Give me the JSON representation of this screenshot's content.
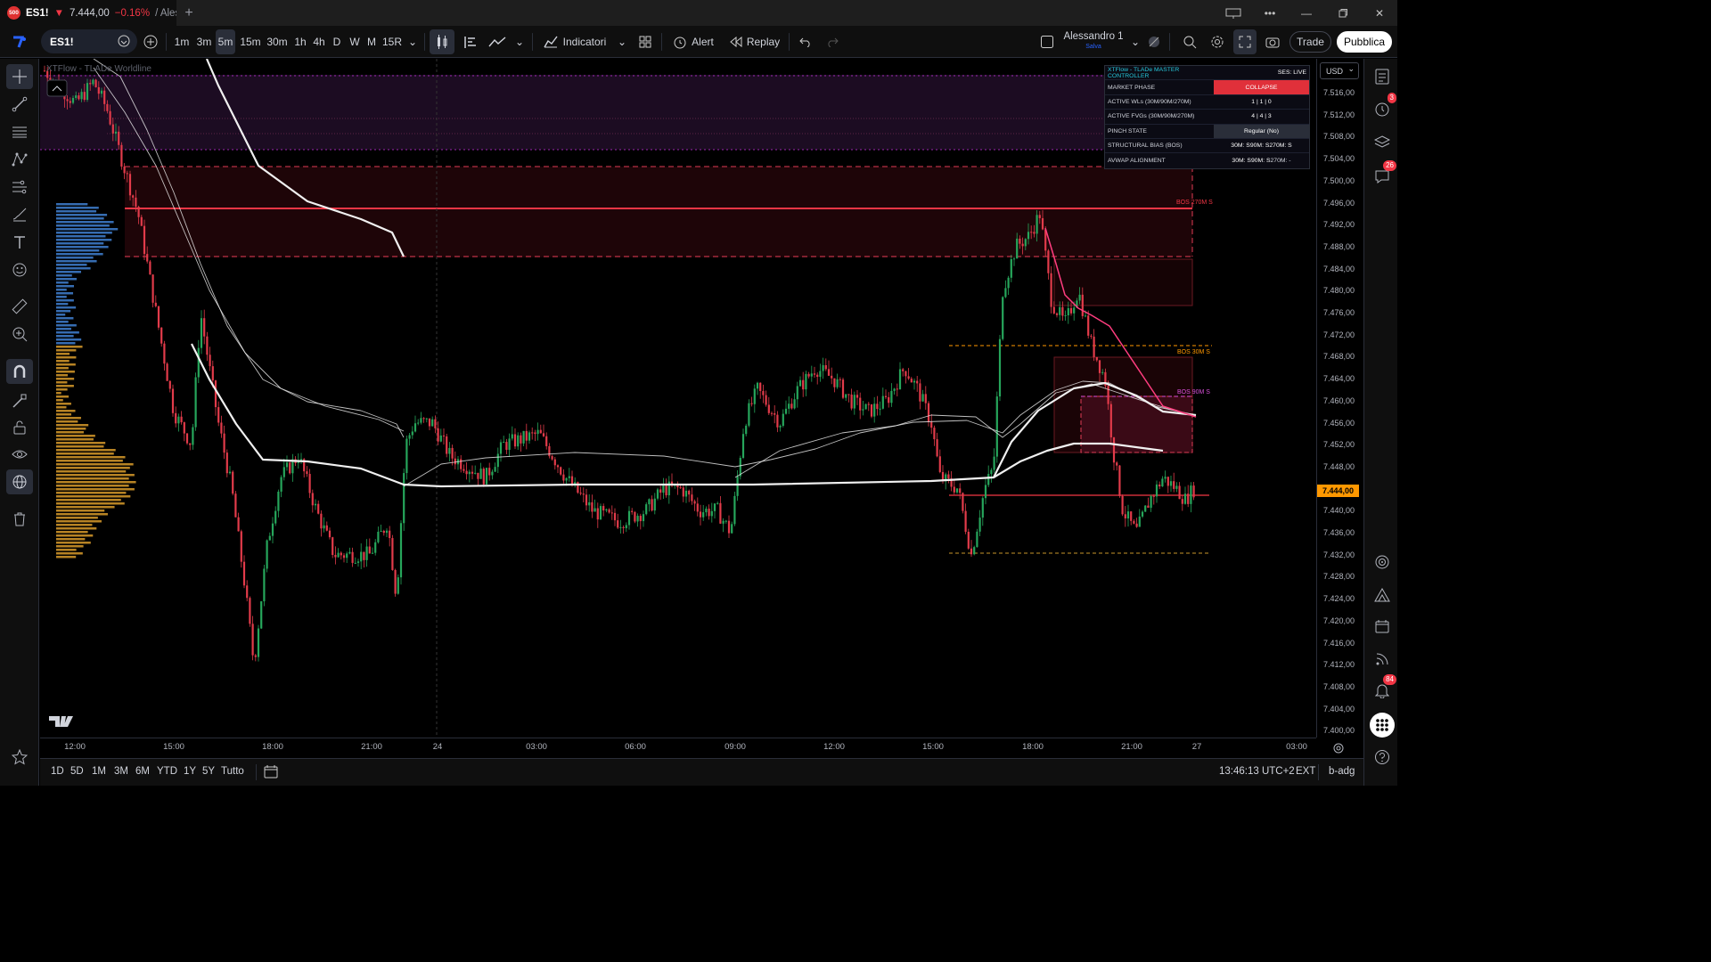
{
  "tab": {
    "badge": "500",
    "symbol": "ES1!",
    "arrow": "▼",
    "price": "7.444,00",
    "change": "−0.16%",
    "rest": "/ Alessa",
    "plus": "+"
  },
  "toolbar": {
    "symbol": "ES1!",
    "intervals": [
      "1m",
      "3m",
      "5m",
      "15m",
      "30m",
      "1h",
      "4h",
      "D",
      "W",
      "M",
      "15R"
    ],
    "active_interval": "5m",
    "indicators_label": "Indicatori",
    "alert_label": "Alert",
    "replay_label": "Replay",
    "layout_name": "Alessandro 1",
    "layout_sub": "Salva",
    "trade_label": "Trade",
    "publish_label": "Pubblica"
  },
  "chart": {
    "watermark": "XTFlow - TLADe Worldline",
    "currency": "USD",
    "current_price": "7.444,00",
    "price_labels": [
      "7.516,00",
      "7.512,00",
      "7.508,00",
      "7.504,00",
      "7.500,00",
      "7.496,00",
      "7.492,00",
      "7.488,00",
      "7.484,00",
      "7.480,00",
      "7.476,00",
      "7.472,00",
      "7.468,00",
      "7.464,00",
      "7.460,00",
      "7.456,00",
      "7.452,00",
      "7.448,00",
      "7.444,00",
      "7.440,00",
      "7.436,00",
      "7.432,00",
      "7.428,00",
      "7.424,00",
      "7.420,00",
      "7.416,00",
      "7.412,00",
      "7.408,00",
      "7.404,00",
      "7.400,00"
    ],
    "time_labels": [
      "12:00",
      "15:00",
      "18:00",
      "21:00",
      "24",
      "03:00",
      "06:00",
      "09:00",
      "12:00",
      "15:00",
      "18:00",
      "21:00",
      "27",
      "03:00"
    ],
    "bos_labels": {
      "b270": "BOS 270M S",
      "b30": "BOS 30M S",
      "b90": "BOS 90M S"
    },
    "colors": {
      "up": "#26a65b",
      "down": "#e23b4a",
      "accent": "#ff9800",
      "bos270": "#f23645",
      "bos30": "#ff9800",
      "bos90": "#d84fd8"
    }
  },
  "table": {
    "title": "XTFlow - TLADe MASTER CONTROLLER",
    "session": "SES: LIVE",
    "rows": [
      {
        "key": "MARKET PHASE",
        "value": "COLLAPSE"
      },
      {
        "key": "ACTIVE WLs (30M/90M/270M)",
        "value": "1 | 1 | 0"
      },
      {
        "key": "ACTIVE FVGs (30M/90M/270M)",
        "value": "4 | 4 | 3"
      },
      {
        "key": "PINCH STATE",
        "value": "Regular (No)"
      }
    ],
    "structural": {
      "key": "STRUCTURAL BIAS (BOS)",
      "a": "30M: S",
      "b": "90M: S",
      "c": "270M: S"
    },
    "avwap": {
      "key": "AVWAP ALIGNMENT",
      "a": "30M: S",
      "b": "90M: S",
      "c": "270M: -"
    }
  },
  "bottom": {
    "ranges": [
      "1D",
      "5D",
      "1M",
      "3M",
      "6M",
      "YTD",
      "1Y",
      "5Y",
      "Tutto"
    ],
    "clock": "13:46:13 UTC+2",
    "ext": "EXT",
    "adg": "b-adg"
  },
  "right_badges": {
    "alerts": "3",
    "chats": "26",
    "notifications": "84"
  },
  "icons": [
    "crosshair-icon",
    "trendline-icon",
    "fib-icon",
    "pattern-icon",
    "forecast-icon",
    "brush-icon",
    "text-icon",
    "emoji-icon",
    "ruler-icon",
    "zoom-icon",
    "magnet-icon",
    "lock-draw-icon",
    "lock-icon",
    "eye-icon",
    "globe-icon",
    "trash-icon"
  ]
}
